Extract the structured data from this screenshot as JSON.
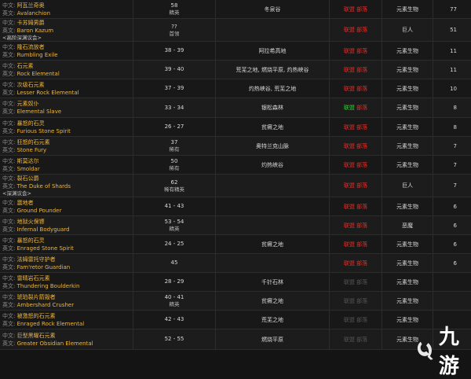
{
  "labels": {
    "zh": "中文:",
    "en": "英文:"
  },
  "rows": [
    {
      "zh": "阿瓦兰奇奥",
      "en": "Avalanchion",
      "note": "",
      "level": "58",
      "rank": "精英",
      "zone": "冬泉谷",
      "faction": [
        {
          "text": "联盟",
          "color": "red"
        },
        {
          "text": "部落",
          "color": "red"
        }
      ],
      "type": "元素生物",
      "count": "77"
    },
    {
      "zh": "卡苏姆男爵",
      "en": "Baron Kazum",
      "note": "<高阶深渊议会>",
      "level": "??",
      "rank": "首领",
      "zone": "",
      "faction": [
        {
          "text": "联盟",
          "color": "red"
        },
        {
          "text": "部落",
          "color": "red"
        }
      ],
      "type": "巨人",
      "count": "51"
    },
    {
      "zh": "隆石流放者",
      "en": "Rumbling Exile",
      "note": "",
      "level": "38 - 39",
      "rank": "",
      "zone": "阿拉希高地",
      "faction": [
        {
          "text": "联盟",
          "color": "red"
        },
        {
          "text": "部落",
          "color": "red"
        }
      ],
      "type": "元素生物",
      "count": "11"
    },
    {
      "zh": "石元素",
      "en": "Rock Elemental",
      "note": "",
      "level": "39 - 40",
      "rank": "",
      "zone": "荒芜之地, 燃烧平原, 灼热峡谷",
      "faction": [
        {
          "text": "联盟",
          "color": "red"
        },
        {
          "text": "部落",
          "color": "red"
        }
      ],
      "type": "元素生物",
      "count": "11"
    },
    {
      "zh": "次级石元素",
      "en": "Lesser Rock Elemental",
      "note": "",
      "level": "37 - 39",
      "rank": "",
      "zone": "灼热峡谷, 荒芜之地",
      "faction": [
        {
          "text": "联盟",
          "color": "red"
        },
        {
          "text": "部落",
          "color": "red"
        }
      ],
      "type": "元素生物",
      "count": "10"
    },
    {
      "zh": "元素奴仆",
      "en": "Elemental Slave",
      "note": "",
      "level": "33 - 34",
      "rank": "",
      "zone": "银松森林",
      "faction": [
        {
          "text": "联盟",
          "color": "green"
        },
        {
          "text": "部落",
          "color": "red"
        }
      ],
      "type": "元素生物",
      "count": "8"
    },
    {
      "zh": "暴怒的石灵",
      "en": "Furious Stone Spirit",
      "note": "",
      "level": "26 - 27",
      "rank": "",
      "zone": "贫瘠之地",
      "faction": [
        {
          "text": "联盟",
          "color": "red"
        },
        {
          "text": "部落",
          "color": "red"
        }
      ],
      "type": "元素生物",
      "count": "8"
    },
    {
      "zh": "狂怒的石元素",
      "en": "Stone Fury",
      "note": "",
      "level": "37",
      "rank": "稀有",
      "zone": "奥特兰克山脉",
      "faction": [
        {
          "text": "联盟",
          "color": "red"
        },
        {
          "text": "部落",
          "color": "red"
        }
      ],
      "type": "元素生物",
      "count": "7"
    },
    {
      "zh": "斯莫达尔",
      "en": "Smoldar",
      "note": "",
      "level": "50",
      "rank": "稀有",
      "zone": "灼热峡谷",
      "faction": [
        {
          "text": "联盟",
          "color": "red"
        },
        {
          "text": "部落",
          "color": "red"
        }
      ],
      "type": "元素生物",
      "count": "7"
    },
    {
      "zh": "裂石公爵",
      "en": "The Duke of Shards",
      "note": "<深渊议会>",
      "level": "62",
      "rank": "稀有精英",
      "zone": "",
      "faction": [
        {
          "text": "联盟",
          "color": "red"
        },
        {
          "text": "部落",
          "color": "red"
        }
      ],
      "type": "巨人",
      "count": "7"
    },
    {
      "zh": "震地者",
      "en": "Ground Pounder",
      "note": "",
      "level": "41 - 43",
      "rank": "",
      "zone": "",
      "faction": [
        {
          "text": "联盟",
          "color": "red"
        },
        {
          "text": "部落",
          "color": "red"
        }
      ],
      "type": "元素生物",
      "count": "6"
    },
    {
      "zh": "地狱火保镖",
      "en": "Infernal Bodyguard",
      "note": "",
      "level": "53 - 54",
      "rank": "精英",
      "zone": "",
      "faction": [
        {
          "text": "联盟",
          "color": "red"
        },
        {
          "text": "部落",
          "color": "red"
        }
      ],
      "type": "恶魔",
      "count": "6"
    },
    {
      "zh": "暴怒的石灵",
      "en": "Enraged Stone Spirit",
      "note": "",
      "level": "24 - 25",
      "rank": "",
      "zone": "贫瘠之地",
      "faction": [
        {
          "text": "联盟",
          "color": "red"
        },
        {
          "text": "部落",
          "color": "red"
        }
      ],
      "type": "元素生物",
      "count": "6"
    },
    {
      "zh": "法姆雷托守护者",
      "en": "Fam'retor Guardian",
      "note": "",
      "level": "45",
      "rank": "",
      "zone": "",
      "faction": [
        {
          "text": "联盟",
          "color": "red"
        },
        {
          "text": "部落",
          "color": "red"
        }
      ],
      "type": "元素生物",
      "count": "6"
    },
    {
      "zh": "雷晴岩石元素",
      "en": "Thundering Boulderkin",
      "note": "",
      "level": "28 - 29",
      "rank": "",
      "zone": "千针石林",
      "faction": [
        {
          "text": "联盟",
          "color": "gray"
        },
        {
          "text": "部落",
          "color": "gray"
        }
      ],
      "type": "元素生物",
      "count": ""
    },
    {
      "zh": "琥珀裂片箭毁者",
      "en": "Ambershard Crusher",
      "note": "",
      "level": "40 - 41",
      "rank": "精英",
      "zone": "贫瘠之地",
      "faction": [
        {
          "text": "联盟",
          "color": "gray"
        },
        {
          "text": "部落",
          "color": "gray"
        }
      ],
      "type": "元素生物",
      "count": ""
    },
    {
      "zh": "被激怒的石元素",
      "en": "Enraged Rock Elemental",
      "note": "",
      "level": "42 - 43",
      "rank": "",
      "zone": "荒芜之地",
      "faction": [
        {
          "text": "联盟",
          "color": "gray"
        },
        {
          "text": "部落",
          "color": "gray"
        }
      ],
      "type": "元素生物",
      "count": ""
    },
    {
      "zh": "巨型黑曜石元素",
      "en": "Greater Obsidian Elemental",
      "note": "",
      "level": "52 - 55",
      "rank": "",
      "zone": "燃烧平原",
      "faction": [
        {
          "text": "联盟",
          "color": "gray"
        },
        {
          "text": "部落",
          "color": "gray"
        }
      ],
      "type": "元素生物",
      "count": ""
    }
  ],
  "watermark": {
    "text": "九游"
  }
}
